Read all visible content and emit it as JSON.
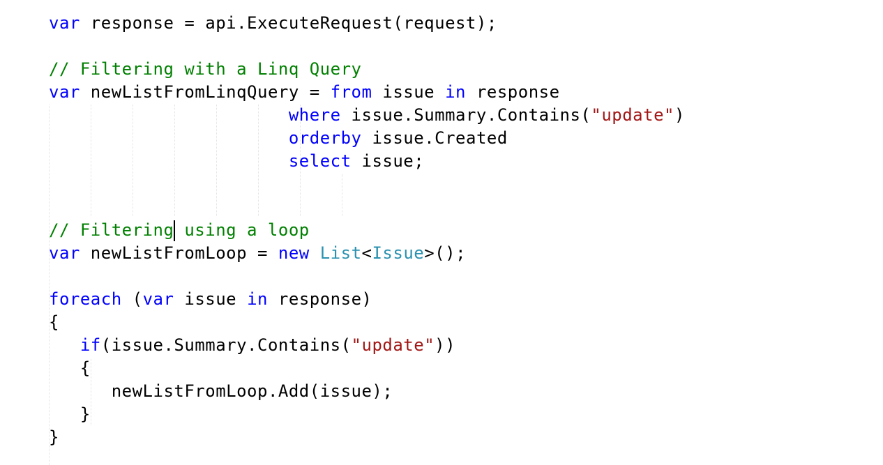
{
  "colors": {
    "keyword": "#0000ff",
    "type": "#2b91af",
    "string": "#a31515",
    "comment": "#008000",
    "plain": "#000000",
    "background": "#ffffff"
  },
  "code": {
    "line1": {
      "t0": "var",
      "t1": " response = api.ExecuteRequest(request);"
    },
    "line3": {
      "t0": "// Filtering with a Linq Query"
    },
    "line4": {
      "t0": "var",
      "t1": " newListFromLinqQuery = ",
      "t2": "from",
      "t3": " issue ",
      "t4": "in",
      "t5": " response"
    },
    "line5": {
      "indent": "                       ",
      "t0": "where",
      "t1": " issue.Summary.Contains(",
      "t2": "\"update\"",
      "t3": ")"
    },
    "line6": {
      "indent": "                       ",
      "t0": "orderby",
      "t1": " issue.Created"
    },
    "line7": {
      "indent": "                       ",
      "t0": "select",
      "t1": " issue;"
    },
    "line10": {
      "t0": "// Filtering using a loop"
    },
    "line11": {
      "t0": "var",
      "t1": " newListFromLoop = ",
      "t2": "new",
      "t3": " ",
      "t4": "List",
      "t5": "<",
      "t6": "Issue",
      "t7": ">();"
    },
    "line13": {
      "t0": "foreach",
      "t1": " (",
      "t2": "var",
      "t3": " issue ",
      "t4": "in",
      "t5": " response)"
    },
    "line14": {
      "t0": "{"
    },
    "line15": {
      "indent": "   ",
      "t0": "if",
      "t1": "(issue.Summary.Contains(",
      "t2": "\"update\"",
      "t3": "))"
    },
    "line16": {
      "indent": "   ",
      "t0": "{"
    },
    "line17": {
      "indent": "      ",
      "t0": "newListFromLoop.Add(issue);"
    },
    "line18": {
      "indent": "   ",
      "t0": "}"
    },
    "line19": {
      "t0": "}"
    }
  }
}
